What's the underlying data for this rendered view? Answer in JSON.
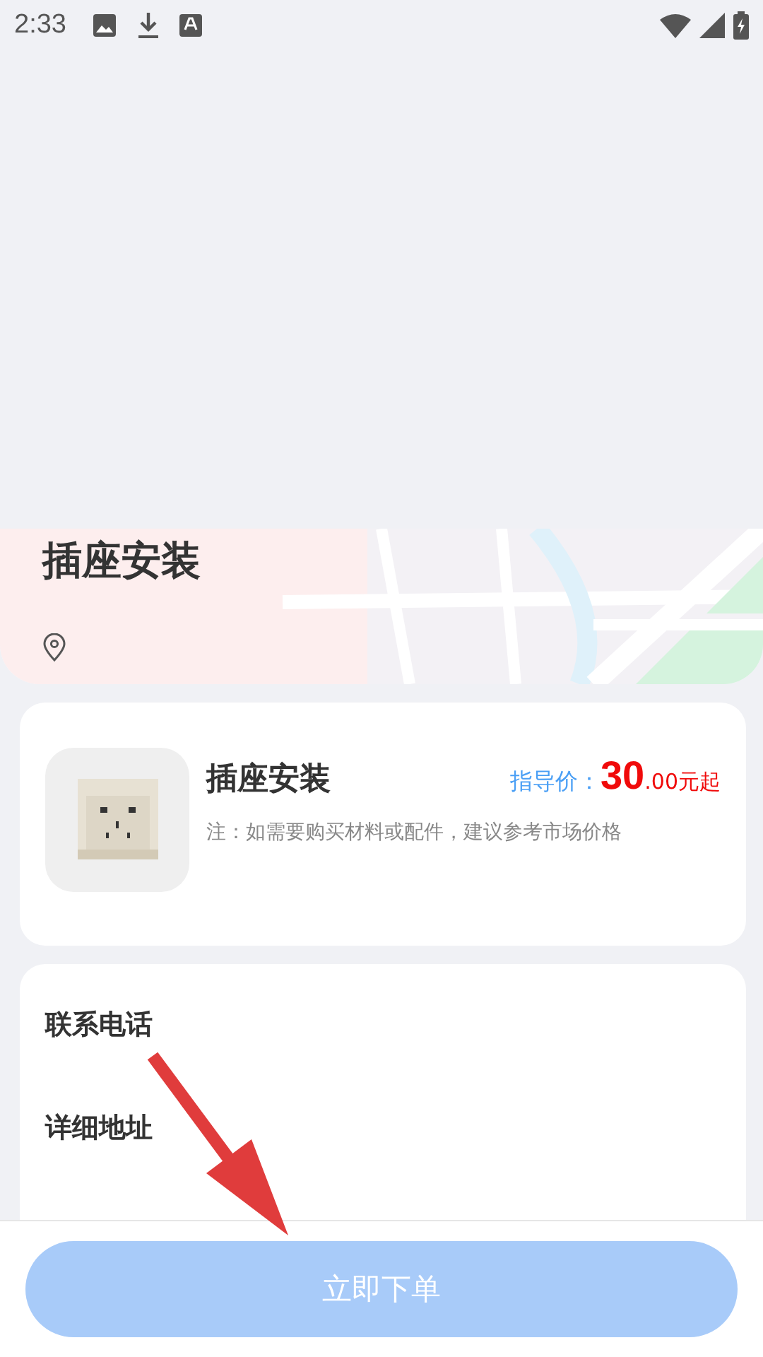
{
  "status_bar": {
    "time": "2:33"
  },
  "header": {
    "title": "插座安装"
  },
  "product": {
    "name": "插座安装",
    "price_label": "指导价：",
    "price_int": "30",
    "price_dec": ".00元起",
    "note": "注：如需要购买材料或配件，建议参考市场价格"
  },
  "form": {
    "fields": [
      {
        "label": "联系电话"
      },
      {
        "label": "详细地址"
      }
    ]
  },
  "overlay": {
    "kind": "arrow"
  },
  "submit": {
    "label": "立即下单",
    "disabled": true
  }
}
